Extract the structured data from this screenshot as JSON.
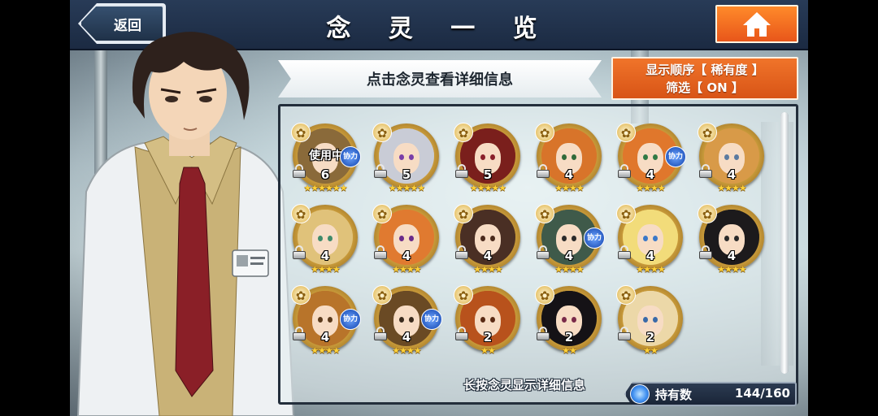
{
  "header": {
    "title": "念 灵 一 览",
    "back_label": "返回"
  },
  "hint": "点击念灵查看详细信息",
  "sort_filter": {
    "sort_line": "显示顺序【 稀有度 】",
    "filter_line": "筛选【 ON 】"
  },
  "spirits": [
    {
      "level": "6",
      "stars": "★★★★★★",
      "in_use": "使用中",
      "assist": "协力",
      "hair": "#8a6a3a",
      "eye": "#6b4a1c"
    },
    {
      "level": "5",
      "stars": "★★★★★",
      "in_use": "",
      "assist": "",
      "hair": "#c9ccd6",
      "eye": "#7a3ea8"
    },
    {
      "level": "5",
      "stars": "★★★★★",
      "in_use": "",
      "assist": "",
      "hair": "#7a1f1c",
      "eye": "#8a1f2a"
    },
    {
      "level": "4",
      "stars": "★★★★",
      "in_use": "",
      "assist": "",
      "hair": "#d8742a",
      "eye": "#2f6a3a"
    },
    {
      "level": "4",
      "stars": "★★★★",
      "in_use": "",
      "assist": "协力",
      "hair": "#e0772c",
      "eye": "#2f7a44"
    },
    {
      "level": "4",
      "stars": "★★★★",
      "in_use": "",
      "assist": "",
      "hair": "#d89a48",
      "eye": "#5a7aa0"
    },
    {
      "level": "4",
      "stars": "★★★★",
      "in_use": "",
      "assist": "",
      "hair": "#e0c27a",
      "eye": "#3f8a6a"
    },
    {
      "level": "4",
      "stars": "★★★★",
      "in_use": "",
      "assist": "",
      "hair": "#e07a30",
      "eye": "#6a2a8a"
    },
    {
      "level": "4",
      "stars": "★★★★",
      "in_use": "",
      "assist": "",
      "hair": "#4a2f24",
      "eye": "#4a2a1c"
    },
    {
      "level": "4",
      "stars": "★★★★",
      "in_use": "",
      "assist": "协力",
      "hair": "#3f5a4a",
      "eye": "#2a2a2a"
    },
    {
      "level": "4",
      "stars": "★★★★",
      "in_use": "",
      "assist": "",
      "hair": "#f2dc7a",
      "eye": "#3a78c8"
    },
    {
      "level": "4",
      "stars": "★★★★",
      "in_use": "",
      "assist": "",
      "hair": "#1c1a1c",
      "eye": "#2a2a2a"
    },
    {
      "level": "4",
      "stars": "★★★★",
      "in_use": "",
      "assist": "协力",
      "hair": "#b8742a",
      "eye": "#5a3a1c"
    },
    {
      "level": "4",
      "stars": "★★★★",
      "in_use": "",
      "assist": "协力",
      "hair": "#6a4a24",
      "eye": "#3a2a1c"
    },
    {
      "level": "2",
      "stars": "★★",
      "in_use": "",
      "assist": "",
      "hair": "#b8521c",
      "eye": "#5a2a14"
    },
    {
      "level": "2",
      "stars": "★★",
      "in_use": "",
      "assist": "",
      "hair": "#151216",
      "eye": "#7a2a4a"
    },
    {
      "level": "2",
      "stars": "★★",
      "in_use": "",
      "assist": "",
      "hair": "#ecd8a8",
      "eye": "#3a6aa8"
    }
  ],
  "footer": {
    "longpress_hint": "长按念灵显示详细信息",
    "owned_label": "持有数",
    "owned_count": "144/160"
  }
}
